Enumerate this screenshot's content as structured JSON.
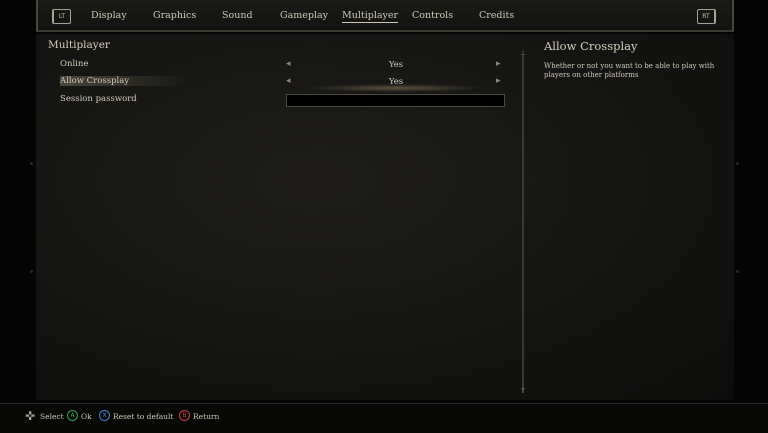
{
  "tabs": {
    "left_trigger": "LT",
    "right_trigger": "RT",
    "items": [
      "Display",
      "Graphics",
      "Sound",
      "Gameplay",
      "Multiplayer",
      "Controls",
      "Credits"
    ],
    "active": "Multiplayer"
  },
  "section": {
    "title": "Multiplayer"
  },
  "settings": [
    {
      "label": "Online",
      "value": "Yes"
    },
    {
      "label": "Allow Crossplay",
      "value": "Yes"
    },
    {
      "label": "Session password",
      "value": ""
    }
  ],
  "description": {
    "title": "Allow Crossplay",
    "text": "Whether or not you want to be able to play with players on other platforms"
  },
  "footer": {
    "select": {
      "button": "dpad-icon",
      "label": "Select"
    },
    "ok": {
      "button": "A",
      "label": "Ok",
      "color": "#3aa35a"
    },
    "reset": {
      "button": "X",
      "label": "Reset to default",
      "color": "#4a7fd0"
    },
    "return": {
      "button": "B",
      "label": "Return",
      "color": "#c8404a"
    }
  },
  "colors": {
    "text": "#cfc8b8",
    "panel": "#141412",
    "accent_glow": "#aa966e"
  }
}
